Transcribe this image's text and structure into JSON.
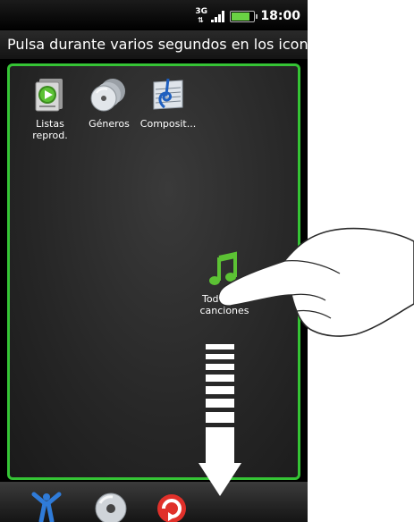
{
  "status_bar": {
    "network_label": "3G",
    "time": "18:00",
    "battery_level": 0.8,
    "battery_color": "#6ad244"
  },
  "instruction_banner": {
    "text": "Pulsa durante varios segundos en los icon..."
  },
  "panel": {
    "border_color": "#35c435",
    "apps": [
      {
        "label": "Listas reprod.",
        "icon": "playlist-icon"
      },
      {
        "label": "Géneros",
        "icon": "genres-disc-icon"
      },
      {
        "label": "Composit...",
        "icon": "composer-icon"
      }
    ],
    "dragged_app": {
      "label": "Todas las canciones",
      "icon": "music-note-icon"
    }
  },
  "dock": {
    "items": [
      {
        "icon": "artist-icon"
      },
      {
        "icon": "album-disc-icon"
      },
      {
        "icon": "repeat-icon"
      }
    ]
  },
  "overlay": {
    "hand": "pointing-hand-icon",
    "arrow": "drag-down-arrow-icon"
  }
}
